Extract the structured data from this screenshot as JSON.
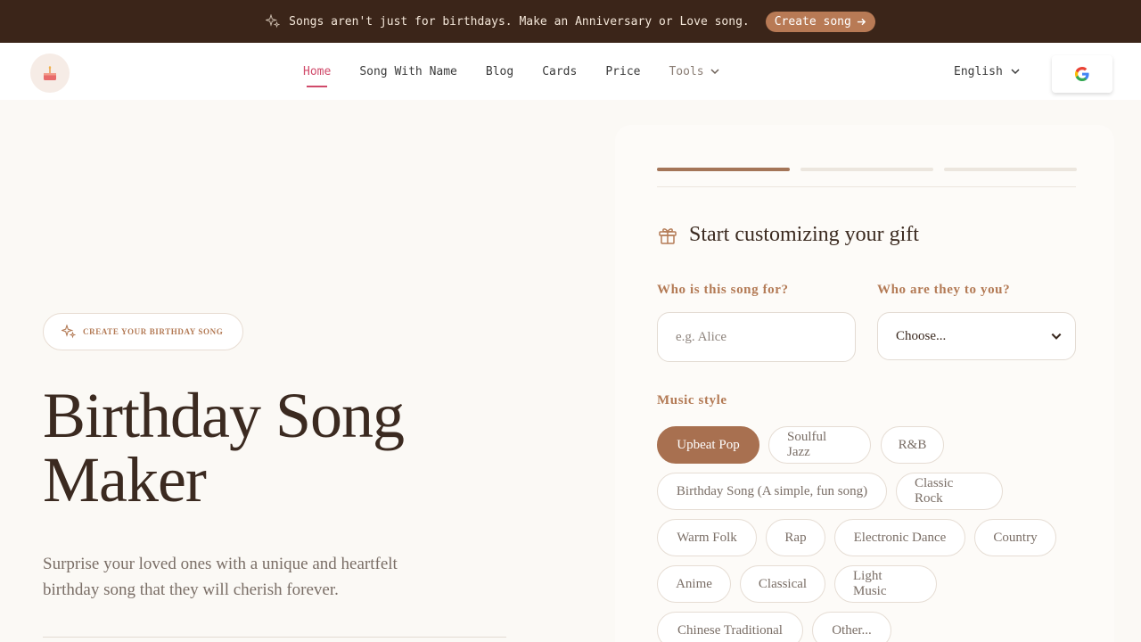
{
  "announcement": {
    "text": "Songs aren't just for birthdays. Make an Anniversary or Love song.",
    "cta_label": "Create song",
    "cta_icon": "arrow-right-icon"
  },
  "nav": {
    "items": [
      {
        "label": "Home",
        "active": true
      },
      {
        "label": "Song With Name"
      },
      {
        "label": "Blog"
      },
      {
        "label": "Cards"
      },
      {
        "label": "Price"
      },
      {
        "label": "Tools"
      }
    ],
    "language": "English"
  },
  "hero": {
    "badge": "CREATE YOUR BIRTHDAY SONG",
    "title_line1": "Birthday Song",
    "title_line2": "Maker",
    "subtitle": "Surprise your loved ones with a unique and heartfelt birthday song that they will cherish forever."
  },
  "form": {
    "steps_total": 3,
    "step_current": 1,
    "title": "Start customizing your gift",
    "recipient_label": "Who is this song for?",
    "recipient_placeholder": "e.g. Alice",
    "relation_label": "Who are they to you?",
    "relation_value": "Choose...",
    "style_label": "Music style",
    "styles": [
      {
        "label": "Upbeat Pop",
        "selected": true
      },
      {
        "label": "Soulful Jazz"
      },
      {
        "label": "R&B"
      },
      {
        "label": "Birthday Song (A simple, fun song)"
      },
      {
        "label": "Classic Rock"
      },
      {
        "label": "Warm Folk"
      },
      {
        "label": "Rap"
      },
      {
        "label": "Electronic Dance"
      },
      {
        "label": "Country"
      },
      {
        "label": "Anime"
      },
      {
        "label": "Classical"
      },
      {
        "label": "Light Music"
      },
      {
        "label": "Chinese Traditional"
      },
      {
        "label": "Other..."
      }
    ]
  },
  "colors": {
    "brand_brown": "#3b2519",
    "accent": "#b87a55",
    "active_nav": "#d04a6a"
  }
}
